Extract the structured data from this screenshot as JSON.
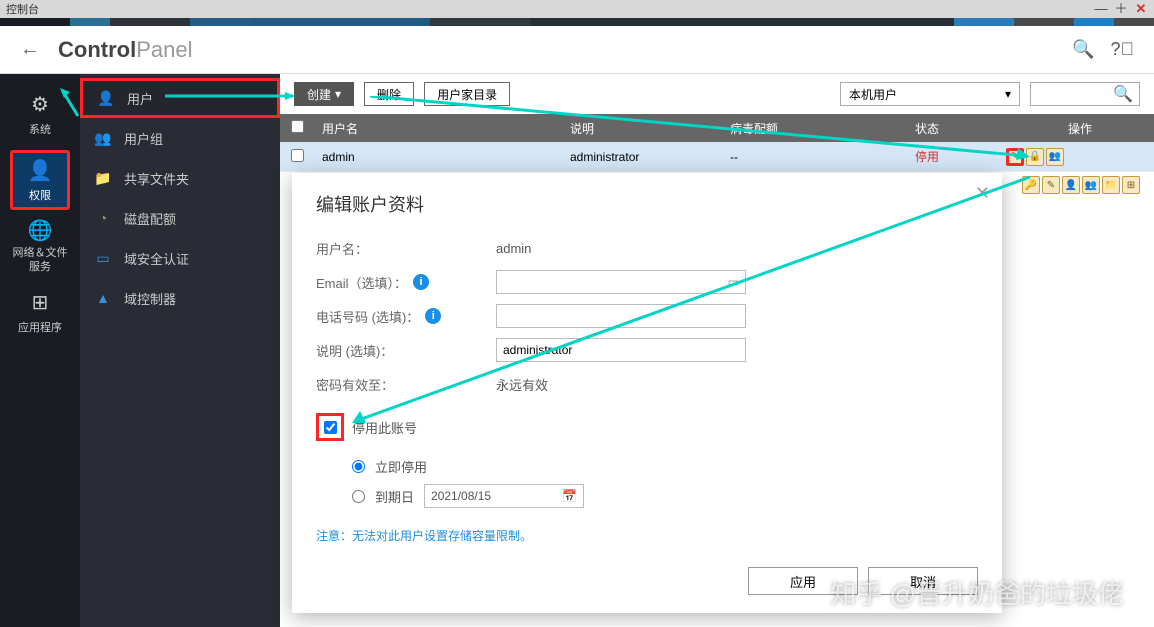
{
  "titlebar": {
    "title": "控制台"
  },
  "brand": {
    "bold": "Control",
    "light": "Panel"
  },
  "rail": {
    "system": "系统",
    "permission": "权限",
    "network": "网络＆文件\n服务",
    "apps": "应用程序"
  },
  "sidebar": {
    "users": "用户",
    "groups": "用户组",
    "shared": "共享文件夹",
    "quota": "磁盘配额",
    "domain": "域安全认证",
    "dc": "域控制器"
  },
  "toolbar": {
    "create": "创建",
    "delete": "删除",
    "home": "用户家目录",
    "scope": "本机用户"
  },
  "table": {
    "h_name": "用户名",
    "h_desc": "说明",
    "h_virus": "病毒配额",
    "h_status": "状态",
    "h_actions": "操作",
    "row1": {
      "name": "admin",
      "desc": "administrator",
      "virus": "--",
      "status": "停用"
    }
  },
  "modal": {
    "title": "编辑账户资料",
    "username_label": "用户名：",
    "username_val": "admin",
    "email_label": "Email（选填）：",
    "phone_label": "电话号码 (选填)：",
    "desc_label": "说明 (选填)：",
    "desc_val": "administrator",
    "pwvalid_label": "密码有效至：",
    "pwvalid_val": "永远有效",
    "disable_label": "停用此账号",
    "radio_now": "立即停用",
    "radio_date": "到期日",
    "date_val": "2021/08/15",
    "note": "注意：无法对此用户设置存储容量限制。",
    "apply": "应用",
    "cancel": "取消"
  },
  "watermark": "知乎 @晋升奶爸的垃圾佬"
}
